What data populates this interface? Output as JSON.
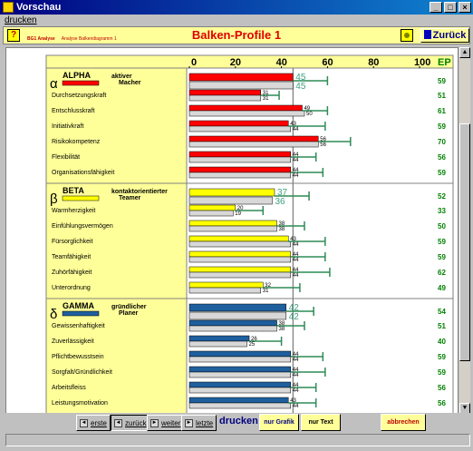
{
  "window": {
    "title": "Vorschau",
    "min": "_",
    "max": "□",
    "close": "×"
  },
  "menu": {
    "print": "drucken"
  },
  "header": {
    "help": "?",
    "meta1": "BG1 Analyse",
    "meta2": "Analyse Balkendiagramm 1",
    "title": "Balken-Profile 1",
    "back": "Zurück"
  },
  "chart_data": {
    "type": "bar",
    "title": "",
    "xlim": [
      0,
      100
    ],
    "xticks": [
      "0",
      "20",
      "40",
      "60",
      "80",
      "100"
    ],
    "ep_label": "EP",
    "groups": [
      {
        "greek": "α",
        "name": "ALPHA",
        "desc": [
          "aktiver",
          "Macher"
        ],
        "color": "#ff0000",
        "summary": {
          "score": 45,
          "score2": 45,
          "err": 60,
          "ep": 59
        },
        "items": [
          {
            "label": "Durchsetzungskraft",
            "v1": 31,
            "v2": 31,
            "err": 39,
            "ep": 51
          },
          {
            "label": "Entschlusskraft",
            "v1": 49,
            "v2": 50,
            "err": 60,
            "ep": 61
          },
          {
            "label": "Initiativkraft",
            "v1": 43,
            "v2": 44,
            "err": 59,
            "ep": 59
          },
          {
            "label": "Risikokompetenz",
            "v1": 56,
            "v2": 56,
            "err": 70,
            "ep": 70
          },
          {
            "label": "Flexibilität",
            "v1": 44,
            "v2": 44,
            "err": 55,
            "ep": 56
          },
          {
            "label": "Organisationsfähigkeit",
            "v1": 44,
            "v2": 44,
            "err": 58,
            "ep": 59
          }
        ]
      },
      {
        "greek": "β",
        "name": "BETA",
        "desc": [
          "kontaktorientierter",
          "Teamer"
        ],
        "color": "#ffff00",
        "summary": {
          "score": 37,
          "score2": 36,
          "err": 52,
          "ep": 52
        },
        "items": [
          {
            "label": "Warmherzigkeit",
            "v1": 20,
            "v2": 19,
            "err": 32,
            "ep": 33
          },
          {
            "label": "Einfühlungsvermögen",
            "v1": 38,
            "v2": 38,
            "err": 50,
            "ep": 50
          },
          {
            "label": "Fürsorglichkeit",
            "v1": 43,
            "v2": 44,
            "err": 59,
            "ep": 59
          },
          {
            "label": "Teamfähigkeit",
            "v1": 44,
            "v2": 44,
            "err": 59,
            "ep": 59
          },
          {
            "label": "Zuhörfähigkeit",
            "v1": 44,
            "v2": 44,
            "err": 61,
            "ep": 62
          },
          {
            "label": "Unterordnung",
            "v1": 32,
            "v2": 31,
            "err": 48,
            "ep": 49
          }
        ]
      },
      {
        "greek": "δ",
        "name": "GAMMA",
        "desc": [
          "gründlicher",
          "Planer"
        ],
        "color": "#1e5f9e",
        "summary": {
          "score": 42,
          "score2": 42,
          "err": 54,
          "ep": 54
        },
        "items": [
          {
            "label": "Gewissenhaftigkeit",
            "v1": 38,
            "v2": 38,
            "err": 50,
            "ep": 51
          },
          {
            "label": "Zuverlässigkeit",
            "v1": 26,
            "v2": 25,
            "err": 40,
            "ep": 40
          },
          {
            "label": "Pflichtbewusstsein",
            "v1": 44,
            "v2": 44,
            "err": 58,
            "ep": 59
          },
          {
            "label": "Sorgfalt/Gründlichkeit",
            "v1": 44,
            "v2": 44,
            "err": 59,
            "ep": 59
          },
          {
            "label": "Arbeitsfleiss",
            "v1": 44,
            "v2": 44,
            "err": 55,
            "ep": 56
          },
          {
            "label": "Leistungsmotivation",
            "v1": 43,
            "v2": 44,
            "err": 55,
            "ep": 56
          }
        ]
      }
    ]
  },
  "footer": {
    "first": "erste",
    "back": "zurück",
    "next": "weiter",
    "last": "letzte",
    "print": "drucken",
    "graph_only": "nur Grafik",
    "text_only": "nur Text",
    "cancel": "abbrechen",
    "accent_link": "#000080",
    "accent_cancel": "#c00000"
  }
}
